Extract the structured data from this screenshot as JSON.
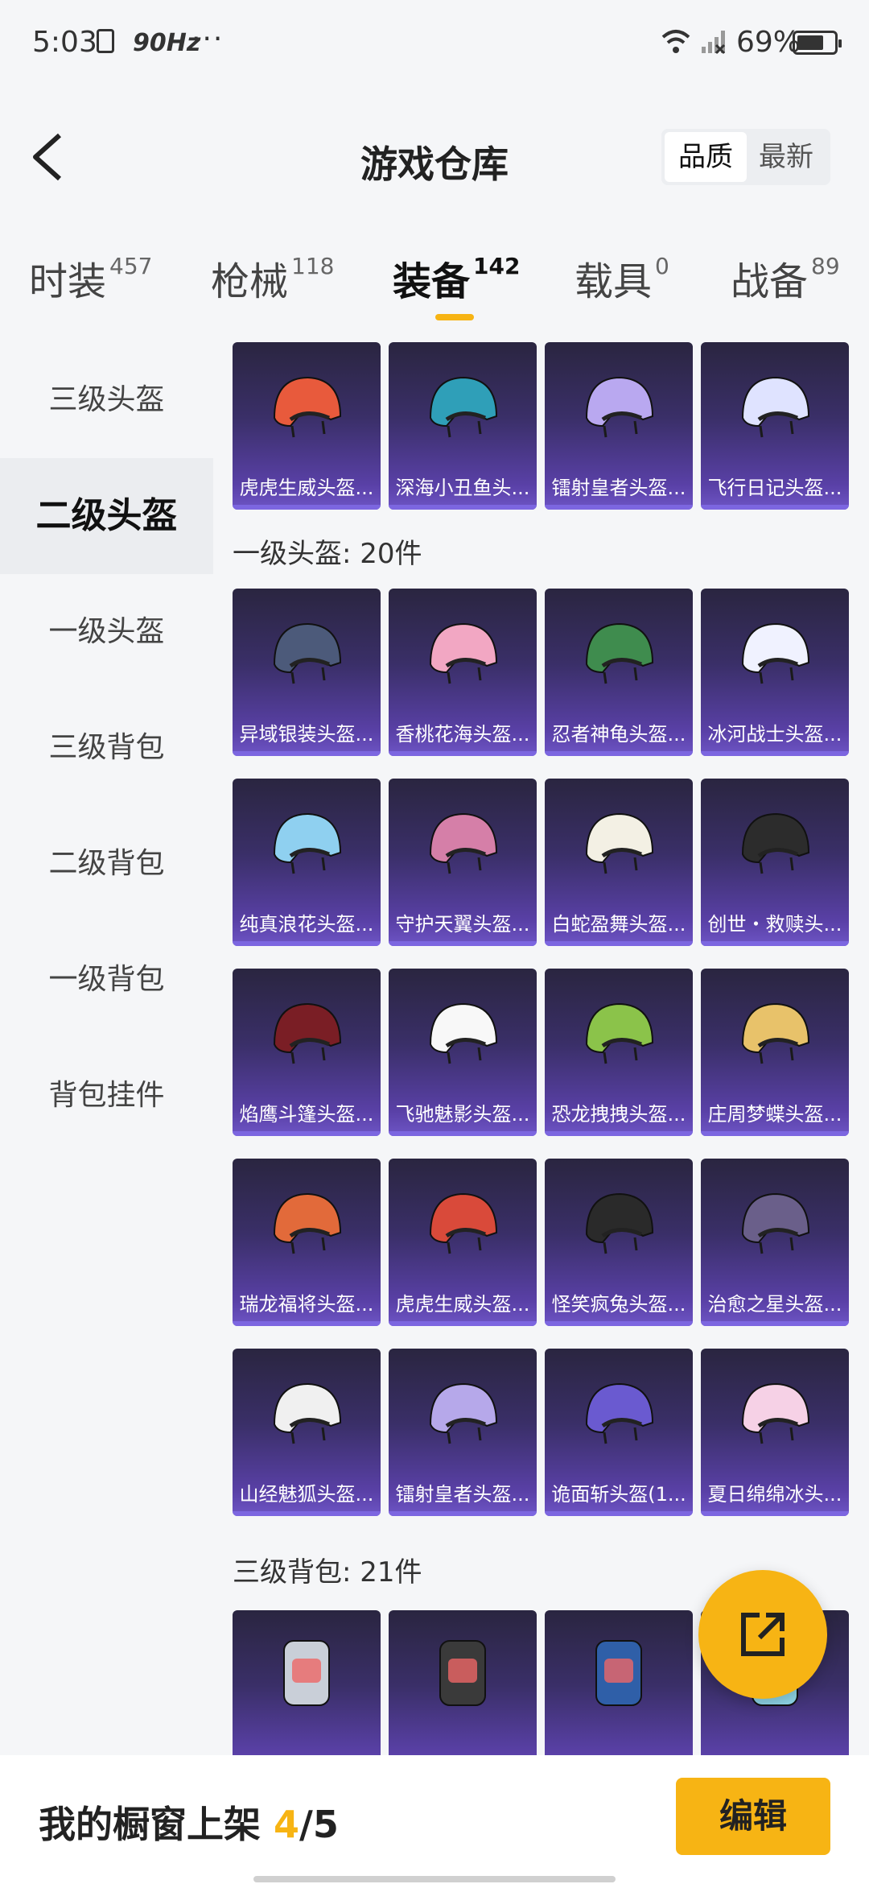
{
  "status_bar": {
    "time": "5:03",
    "refresh_rate": "90Hz",
    "more": "···",
    "battery": "69%"
  },
  "header": {
    "title": "游戏仓库",
    "sort_options": [
      "品质",
      "最新"
    ],
    "sort_active": "品质"
  },
  "tabs": [
    {
      "label": "时装",
      "count": "457"
    },
    {
      "label": "枪械",
      "count": "118"
    },
    {
      "label": "装备",
      "count": "142"
    },
    {
      "label": "载具",
      "count": "0"
    },
    {
      "label": "战备",
      "count": "89"
    }
  ],
  "sidebar": [
    "三级头盔",
    "二级头盔",
    "一级头盔",
    "三级背包",
    "二级背包",
    "一级背包",
    "背包挂件"
  ],
  "sections": {
    "lvl2_top_row": [
      "虎虎生威头盔...",
      "深海小丑鱼头...",
      "镭射皇者头盔...",
      "飞行日记头盔..."
    ],
    "lvl1_title": "一级头盔: 20件",
    "lvl1_items": [
      "异域银装头盔...",
      "香桃花海头盔...",
      "忍者神龟头盔...",
      "冰河战士头盔...",
      "纯真浪花头盔...",
      "守护天翼头盔...",
      "白蛇盈舞头盔...",
      "创世・救赎头...",
      "焰鹰斗篷头盔...",
      "飞驰魅影头盔...",
      "恐龙拽拽头盔...",
      "庄周梦蝶头盔...",
      "瑞龙福将头盔...",
      "虎虎生威头盔...",
      "怪笑疯兔头盔...",
      "治愈之星头盔...",
      "山经魅狐头盔...",
      "镭射皇者头盔...",
      "诡面斩头盔(1...",
      "夏日绵绵冰头..."
    ],
    "bag3_title": "三级背包: 21件"
  },
  "bottom": {
    "shelf_label": "我的橱窗上架",
    "shelf_current": "4",
    "shelf_total": "/5",
    "edit_label": "编辑"
  },
  "colors": {
    "accent": "#f7b414",
    "card_top": "#2a2540",
    "card_bottom": "#6e55c6"
  }
}
